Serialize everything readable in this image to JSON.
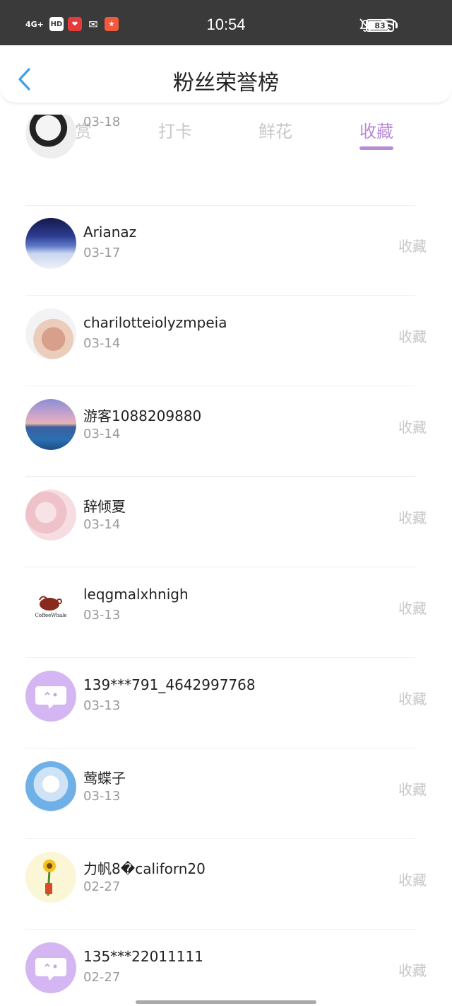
{
  "status_bar": {
    "network": "4G+",
    "hd": "HD",
    "time": "10:54",
    "battery": "83",
    "battery_level": 0.83
  },
  "header": {
    "back_icon": "chevron-left-icon",
    "title": "粉丝荣誉榜"
  },
  "tabs": [
    {
      "label": "打赏",
      "active": false
    },
    {
      "label": "打卡",
      "active": false
    },
    {
      "label": "鲜花",
      "active": false
    },
    {
      "label": "收藏",
      "active": true
    }
  ],
  "colors": {
    "accent": "#b98ad6",
    "inactive": "#c8c8c8"
  },
  "list": {
    "partial_row": {
      "date": "03-18"
    },
    "rows": [
      {
        "name": "Arianaz",
        "date": "03-17",
        "action": "收藏",
        "avatar": "night-landscape"
      },
      {
        "name": "charilotteiolyzmpeia",
        "date": "03-14",
        "action": "收藏",
        "avatar": "photo"
      },
      {
        "name": "游客1088209880",
        "date": "03-14",
        "action": "收藏",
        "avatar": "sunset-sea"
      },
      {
        "name": "辞倾夏",
        "date": "03-14",
        "action": "收藏",
        "avatar": "pink-anime"
      },
      {
        "name": "leqgmalxhnigh",
        "date": "03-13",
        "action": "收藏",
        "avatar": "coffee-whale-logo"
      },
      {
        "name": "139***791_4642997768",
        "date": "03-13",
        "action": "收藏",
        "avatar": "default-chat"
      },
      {
        "name": "莺蝶子",
        "date": "03-13",
        "action": "收藏",
        "avatar": "blue-anime"
      },
      {
        "name": "力帆8�californ20",
        "date": "02-27",
        "action": "收藏",
        "avatar": "sunflower"
      },
      {
        "name": "135***22011111",
        "date": "02-27",
        "action": "收藏",
        "avatar": "default-chat"
      }
    ]
  }
}
